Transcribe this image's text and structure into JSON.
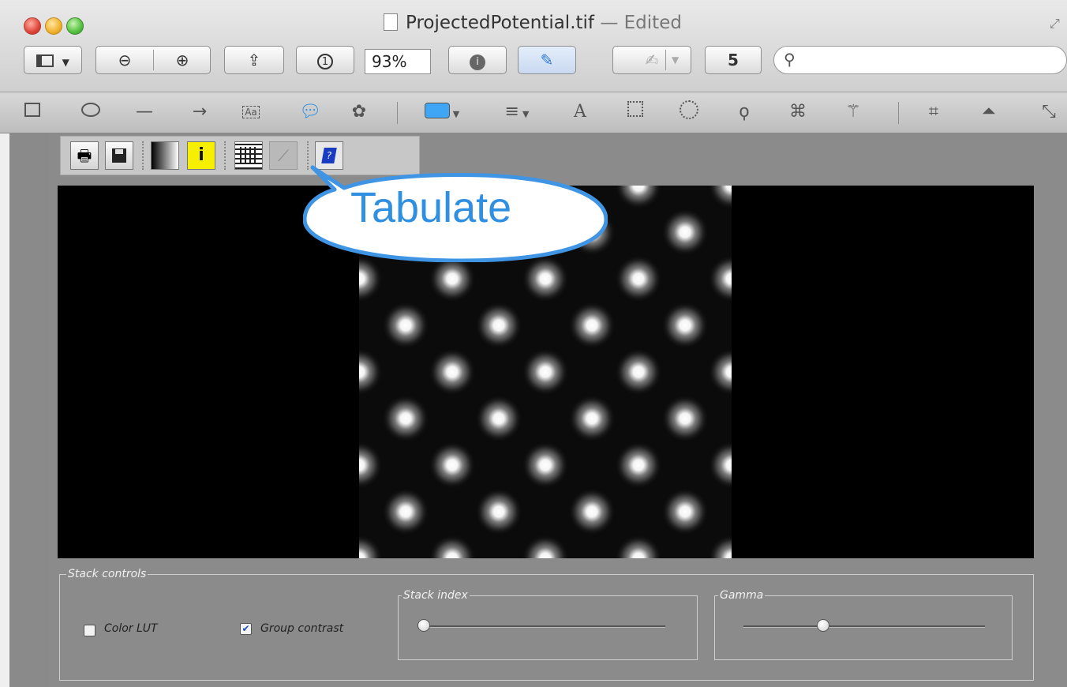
{
  "window": {
    "title": "ProjectedPotential.tif",
    "title_suffix": "— Edited"
  },
  "toolbar": {
    "zoom_value": "93%",
    "actual_size_label": "1",
    "rotate_label": "5",
    "search_placeholder": ""
  },
  "stack_controls": {
    "legend": "Stack controls",
    "color_lut": {
      "label": "Color LUT",
      "checked": false
    },
    "group_contrast": {
      "label": "Group contrast",
      "checked": true
    },
    "stack_index": {
      "legend": "Stack index",
      "value": 0.0
    },
    "gamma": {
      "legend": "Gamma",
      "value": 0.33
    }
  },
  "callout": {
    "text": "Tabulate"
  },
  "icons": {
    "markup": [
      "rectangle-icon",
      "oval-icon",
      "line-icon",
      "arrow-icon",
      "text-box-icon",
      "speech-bubble-icon",
      "star-shape-icon",
      "fill-color-icon",
      "line-style-icon",
      "font-icon",
      "rect-select-icon",
      "ellipse-select-icon",
      "lasso-select-icon",
      "smart-lasso-icon",
      "instant-alpha-icon",
      "crop-icon",
      "adjust-color-icon",
      "adjust-size-icon"
    ],
    "applet": [
      "print-icon",
      "save-icon",
      "contrast-icon",
      "info-icon",
      "tabulate-icon",
      "profile-icon",
      "help-icon"
    ]
  },
  "colors": {
    "accent": "#2f8fe0",
    "canvas": "#000000",
    "info_button": "#f6f000"
  }
}
